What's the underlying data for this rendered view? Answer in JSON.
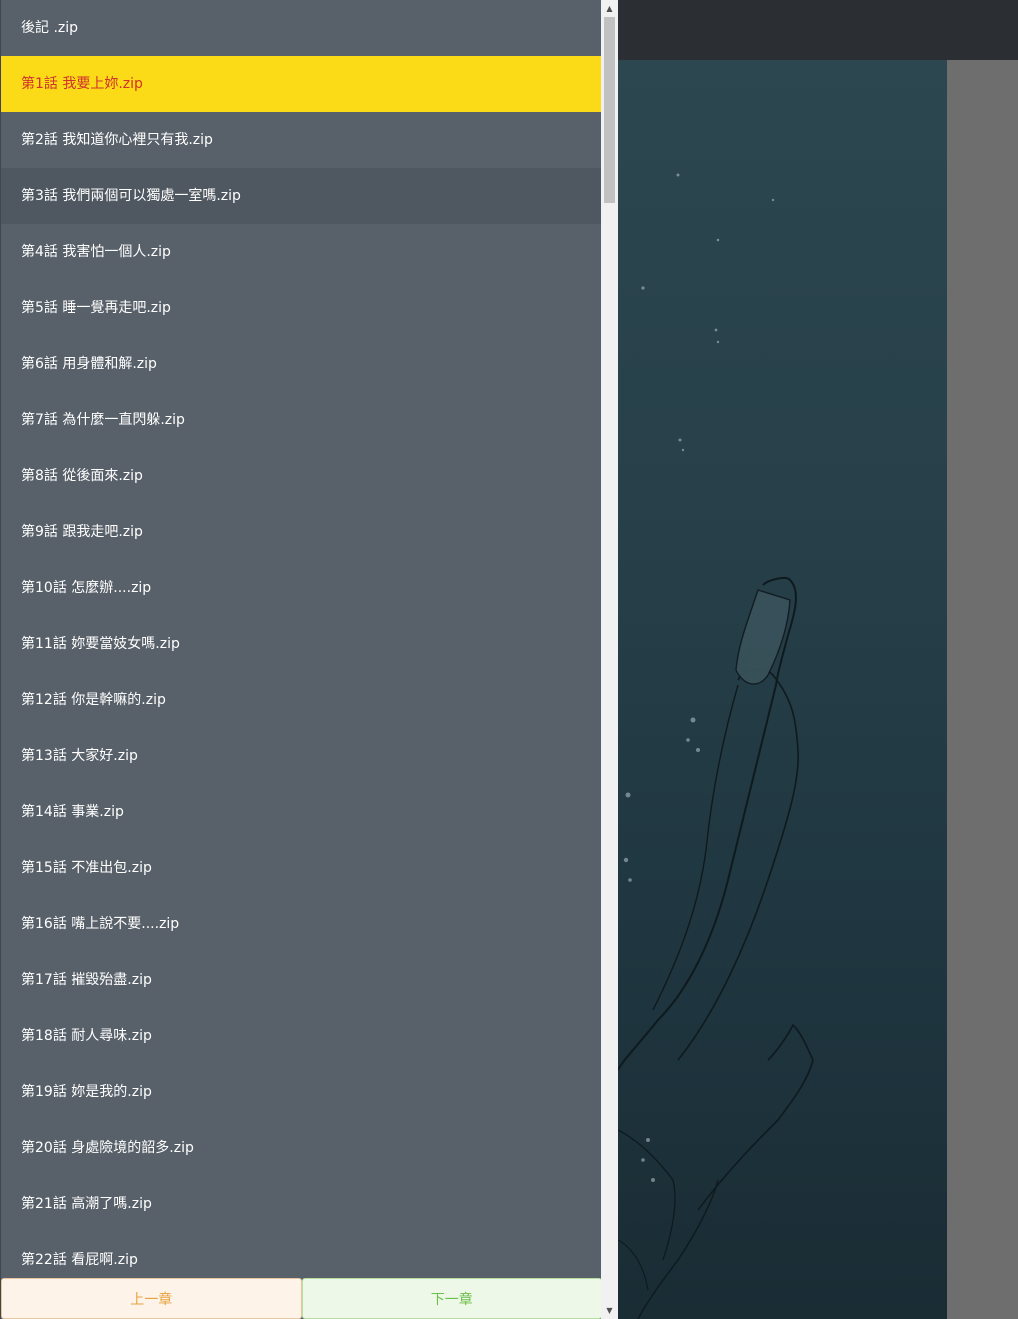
{
  "chapters": [
    {
      "label": "後記 .zip"
    },
    {
      "label": "第1話 我要上妳.zip",
      "state": "active"
    },
    {
      "label": "第2話 我知道你心裡只有我.zip"
    },
    {
      "label": "第3話 我們兩個可以獨處一室嗎.zip",
      "state": "hover"
    },
    {
      "label": "第4話 我害怕一個人.zip"
    },
    {
      "label": "第5話 睡一覺再走吧.zip"
    },
    {
      "label": "第6話 用身體和解.zip"
    },
    {
      "label": "第7話 為什麼一直閃躲.zip"
    },
    {
      "label": "第8話 從後面來.zip"
    },
    {
      "label": "第9話 跟我走吧.zip"
    },
    {
      "label": "第10話 怎麼辦....zip"
    },
    {
      "label": "第11話 妳要當妓女嗎.zip"
    },
    {
      "label": "第12話 你是幹嘛的.zip"
    },
    {
      "label": "第13話 大家好.zip"
    },
    {
      "label": "第14話 事業.zip"
    },
    {
      "label": "第15話 不准出包.zip"
    },
    {
      "label": "第16話 嘴上說不要....zip"
    },
    {
      "label": "第17話 摧毀殆盡.zip"
    },
    {
      "label": "第18話 耐人尋味.zip"
    },
    {
      "label": "第19話 妳是我的.zip"
    },
    {
      "label": "第20話 身處險境的韶多.zip"
    },
    {
      "label": "第21話 高潮了嗎.zip"
    },
    {
      "label": "第22話 看屁啊.zip"
    }
  ],
  "buttons": {
    "prev_label": "上一章",
    "next_label": "下一章"
  },
  "scrollbar": {
    "up_icon": "▲",
    "down_icon": "▼"
  },
  "colors": {
    "drawer_bg": "#586069",
    "active_bg": "#fbdb17",
    "active_text": "#d0312d",
    "prev_text": "#e7a13e",
    "next_text": "#6cbf4a"
  }
}
